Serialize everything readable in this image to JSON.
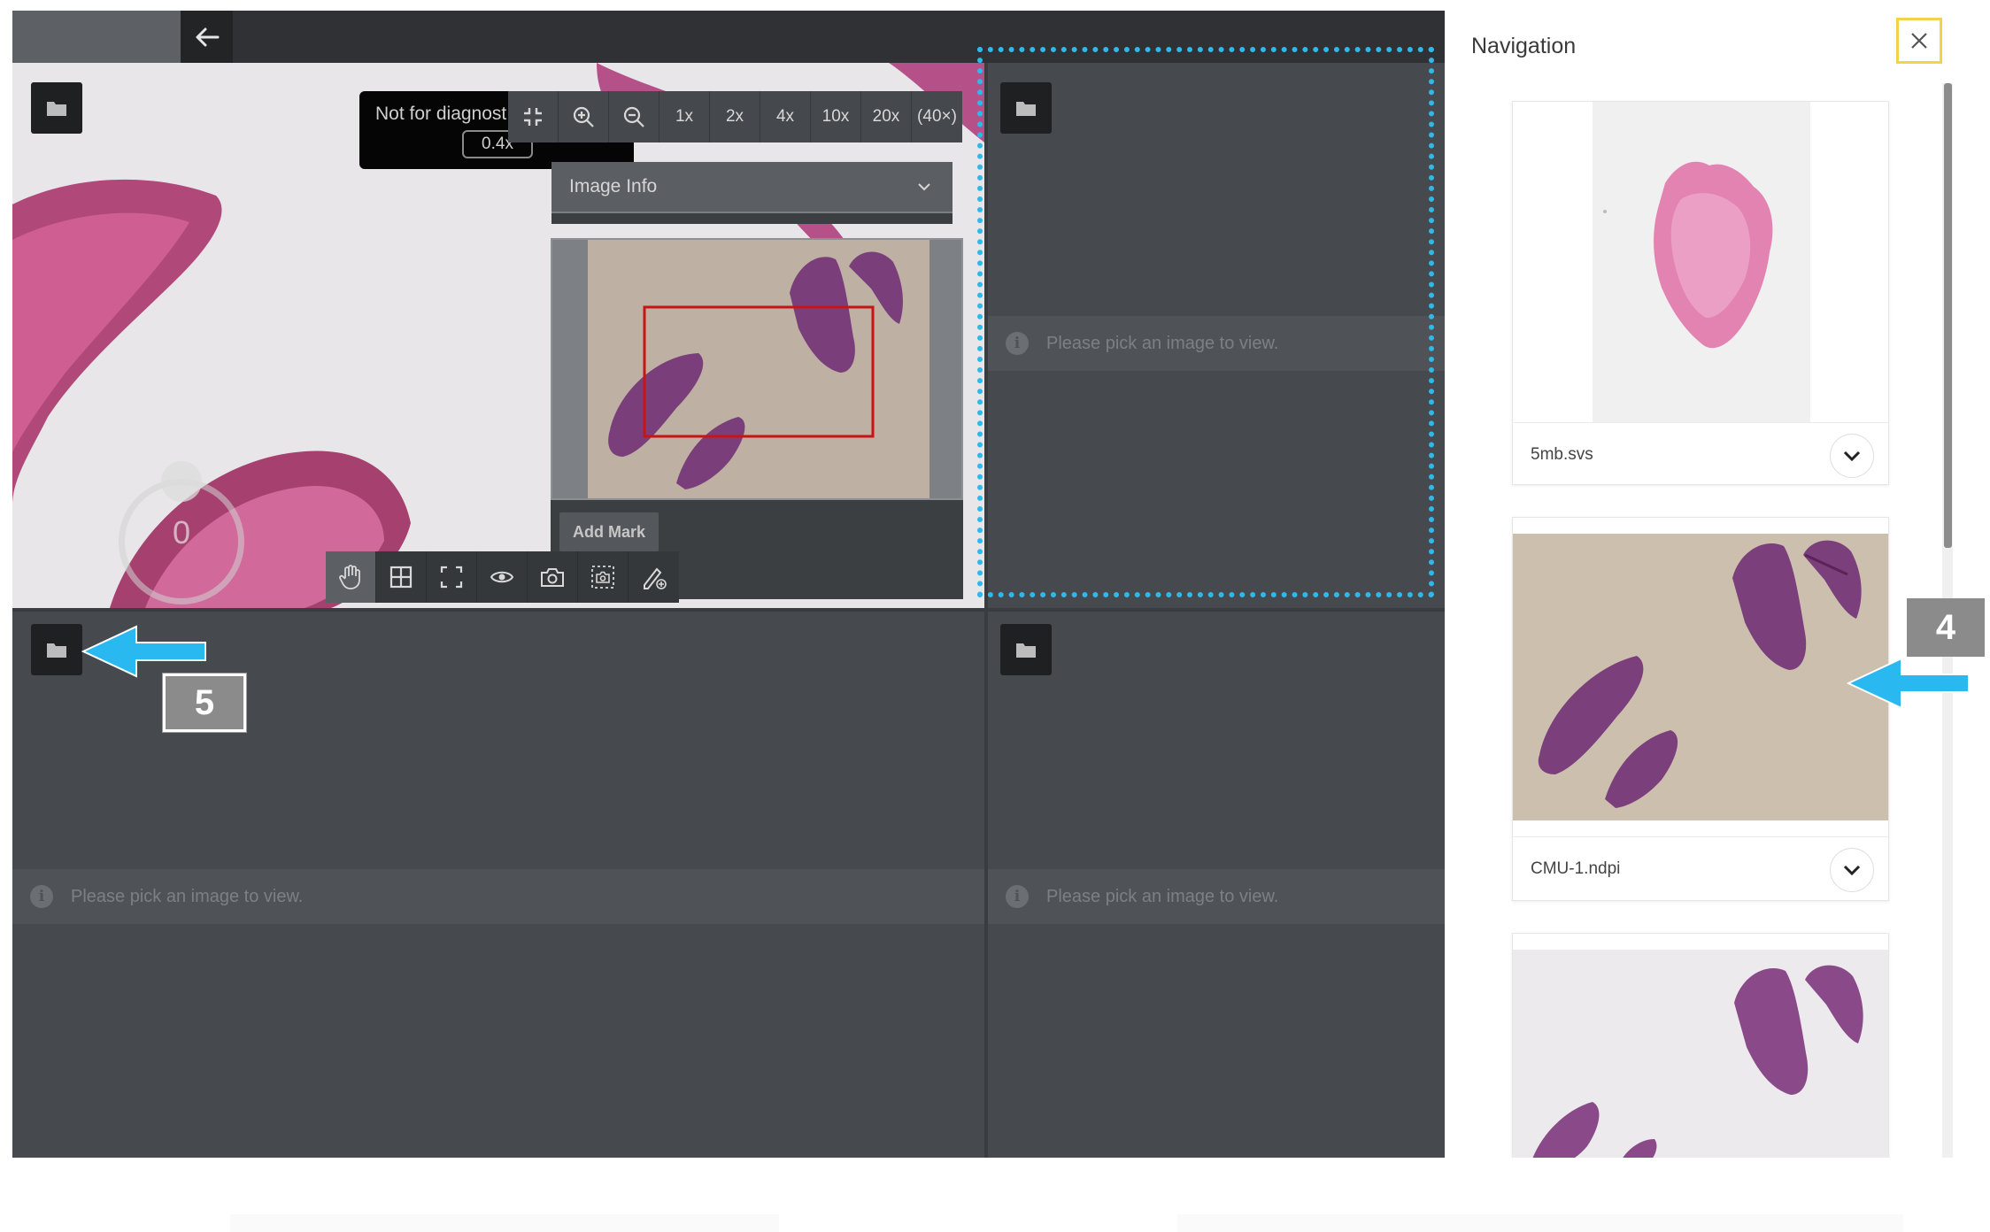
{
  "toolbar": {
    "disclaimer": "Not for diagnost",
    "zoom_level": "0.4x",
    "zoom_presets": [
      "1x",
      "2x",
      "4x",
      "10x",
      "20x",
      "(40×)"
    ]
  },
  "viewer": {
    "image_info_label": "Image Info",
    "add_mark_label": "Add Mark",
    "rotation_value": "0",
    "empty_message": "Please pick an image to view."
  },
  "navigation": {
    "title": "Navigation",
    "slides": [
      {
        "name": "5mb.svs"
      },
      {
        "name": "CMU-1.ndpi"
      }
    ]
  },
  "callouts": {
    "step4": "4",
    "step5": "5"
  },
  "colors": {
    "viewer_bg": "#464a4e",
    "selection_border": "#2fb9ea",
    "callout_arrow": "#29b9f0",
    "callout_bg": "#8b8b8b",
    "close_highlight": "#f3d34a",
    "overview_box": "#c81414"
  },
  "icons": {
    "back": "arrow-left-icon",
    "folder": "folder-icon",
    "fit": "fit-to-screen-icon",
    "zoom_in": "zoom-in-icon",
    "zoom_out": "zoom-out-icon",
    "pan": "hand-icon",
    "grid": "grid-icon",
    "fullscreen": "fullscreen-icon",
    "visibility": "eye-icon",
    "camera": "camera-icon",
    "region": "region-capture-icon",
    "annotate": "pen-icon",
    "close": "close-icon",
    "chevron": "chevron-down-icon",
    "info": "info-icon"
  }
}
